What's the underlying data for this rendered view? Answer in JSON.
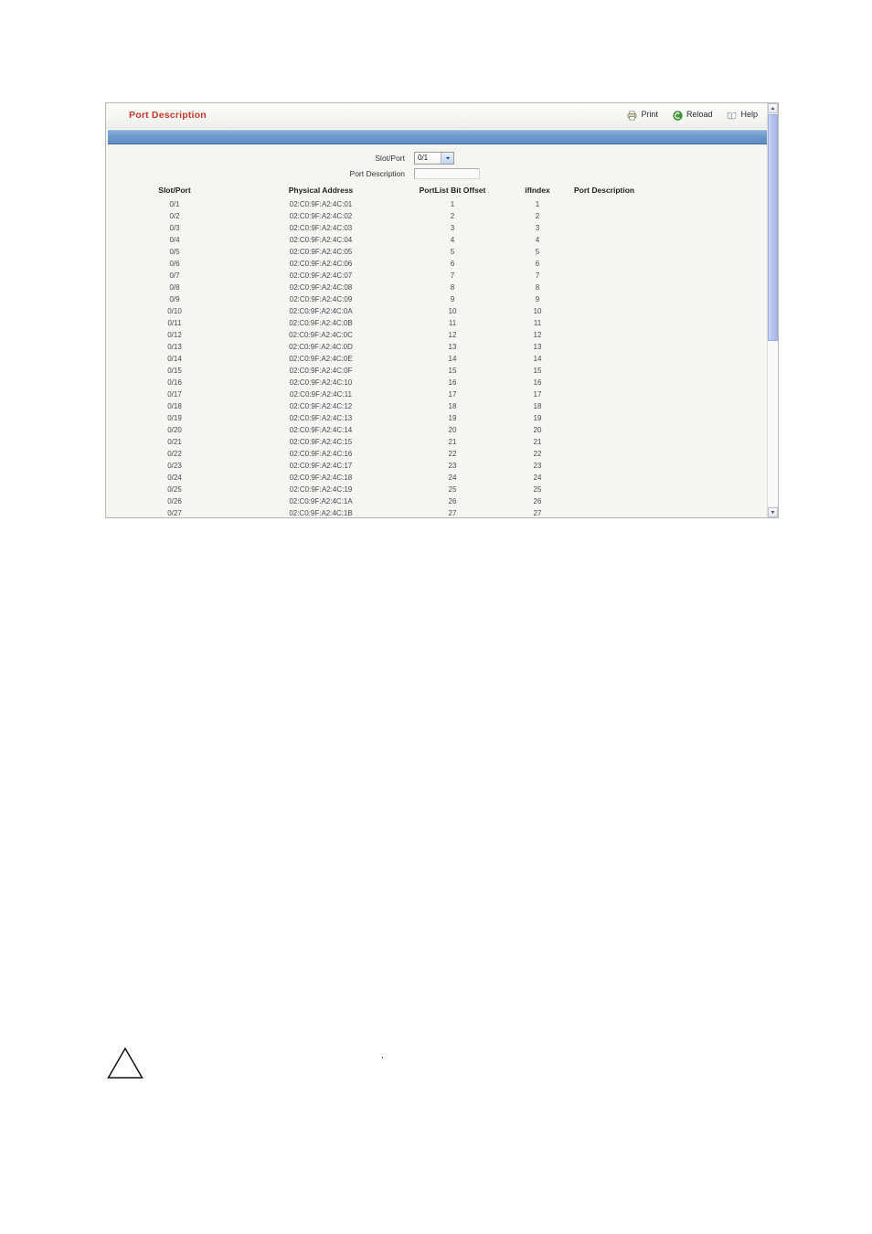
{
  "panel": {
    "title": "Port Description",
    "title_color": "#c0392b",
    "accent_band_color": "#6d99cc"
  },
  "toolbar": {
    "items": [
      {
        "label": "Print",
        "icon": "printer-icon"
      },
      {
        "label": "Reload",
        "icon": "reload-icon"
      },
      {
        "label": "Help",
        "icon": "help-book-icon"
      }
    ]
  },
  "form": {
    "slot_port": {
      "label": "Slot/Port",
      "value": "0/1",
      "options": [
        "0/1"
      ]
    },
    "port_description": {
      "label": "Port Description",
      "value": "",
      "placeholder": ""
    }
  },
  "table": {
    "columns": [
      "Slot/Port",
      "Physical Address",
      "PortList Bit Offset",
      "ifIndex",
      "Port Description"
    ],
    "rows": [
      {
        "slot_port": "0/1",
        "mac": "02:C0:9F:A2:4C:01",
        "offset": "1",
        "ifindex": "1",
        "description": ""
      },
      {
        "slot_port": "0/2",
        "mac": "02:C0:9F:A2:4C:02",
        "offset": "2",
        "ifindex": "2",
        "description": ""
      },
      {
        "slot_port": "0/3",
        "mac": "02:C0:9F:A2:4C:03",
        "offset": "3",
        "ifindex": "3",
        "description": ""
      },
      {
        "slot_port": "0/4",
        "mac": "02:C0:9F:A2:4C:04",
        "offset": "4",
        "ifindex": "4",
        "description": ""
      },
      {
        "slot_port": "0/5",
        "mac": "02:C0:9F:A2:4C:05",
        "offset": "5",
        "ifindex": "5",
        "description": ""
      },
      {
        "slot_port": "0/6",
        "mac": "02:C0:9F:A2:4C:06",
        "offset": "6",
        "ifindex": "6",
        "description": ""
      },
      {
        "slot_port": "0/7",
        "mac": "02:C0:9F:A2:4C:07",
        "offset": "7",
        "ifindex": "7",
        "description": ""
      },
      {
        "slot_port": "0/8",
        "mac": "02:C0:9F:A2:4C:08",
        "offset": "8",
        "ifindex": "8",
        "description": ""
      },
      {
        "slot_port": "0/9",
        "mac": "02:C0:9F:A2:4C:09",
        "offset": "9",
        "ifindex": "9",
        "description": ""
      },
      {
        "slot_port": "0/10",
        "mac": "02:C0:9F:A2:4C:0A",
        "offset": "10",
        "ifindex": "10",
        "description": ""
      },
      {
        "slot_port": "0/11",
        "mac": "02:C0:9F:A2:4C:0B",
        "offset": "11",
        "ifindex": "11",
        "description": ""
      },
      {
        "slot_port": "0/12",
        "mac": "02:C0:9F:A2:4C:0C",
        "offset": "12",
        "ifindex": "12",
        "description": ""
      },
      {
        "slot_port": "0/13",
        "mac": "02:C0:9F:A2:4C:0D",
        "offset": "13",
        "ifindex": "13",
        "description": ""
      },
      {
        "slot_port": "0/14",
        "mac": "02:C0:9F:A2:4C:0E",
        "offset": "14",
        "ifindex": "14",
        "description": ""
      },
      {
        "slot_port": "0/15",
        "mac": "02:C0:9F:A2:4C:0F",
        "offset": "15",
        "ifindex": "15",
        "description": ""
      },
      {
        "slot_port": "0/16",
        "mac": "02:C0:9F:A2:4C:10",
        "offset": "16",
        "ifindex": "16",
        "description": ""
      },
      {
        "slot_port": "0/17",
        "mac": "02:C0:9F:A2:4C:11",
        "offset": "17",
        "ifindex": "17",
        "description": ""
      },
      {
        "slot_port": "0/18",
        "mac": "02:C0:9F:A2:4C:12",
        "offset": "18",
        "ifindex": "18",
        "description": ""
      },
      {
        "slot_port": "0/19",
        "mac": "02:C0:9F:A2:4C:13",
        "offset": "19",
        "ifindex": "19",
        "description": ""
      },
      {
        "slot_port": "0/20",
        "mac": "02:C0:9F:A2:4C:14",
        "offset": "20",
        "ifindex": "20",
        "description": ""
      },
      {
        "slot_port": "0/21",
        "mac": "02:C0:9F:A2:4C:15",
        "offset": "21",
        "ifindex": "21",
        "description": ""
      },
      {
        "slot_port": "0/22",
        "mac": "02:C0:9F:A2:4C:16",
        "offset": "22",
        "ifindex": "22",
        "description": ""
      },
      {
        "slot_port": "0/23",
        "mac": "02:C0:9F:A2:4C:17",
        "offset": "23",
        "ifindex": "23",
        "description": ""
      },
      {
        "slot_port": "0/24",
        "mac": "02:C0:9F:A2:4C:18",
        "offset": "24",
        "ifindex": "24",
        "description": ""
      },
      {
        "slot_port": "0/25",
        "mac": "02:C0:9F:A2:4C:19",
        "offset": "25",
        "ifindex": "25",
        "description": ""
      },
      {
        "slot_port": "0/26",
        "mac": "02:C0:9F:A2:4C:1A",
        "offset": "26",
        "ifindex": "26",
        "description": ""
      },
      {
        "slot_port": "0/27",
        "mac": "02:C0:9F:A2:4C:1B",
        "offset": "27",
        "ifindex": "27",
        "description": ""
      }
    ]
  },
  "page_marks": {
    "stray_comma": ","
  }
}
